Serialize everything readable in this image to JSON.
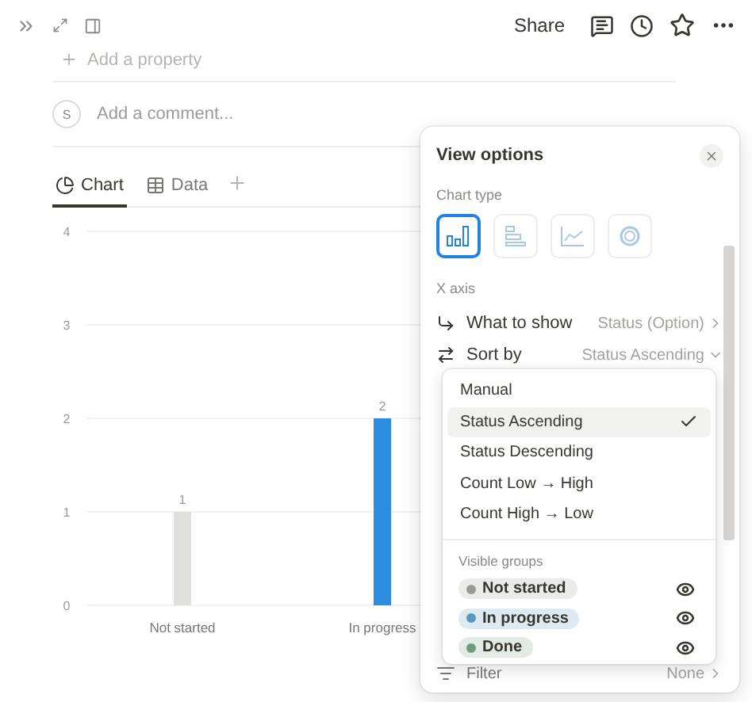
{
  "header": {
    "share": "Share"
  },
  "property_link": "Add a property",
  "comment": {
    "avatar": "S",
    "placeholder": "Add a comment..."
  },
  "view_tabs": [
    {
      "label": "Chart",
      "kind": "chart",
      "selected": true
    },
    {
      "label": "Data",
      "kind": "table",
      "selected": false
    }
  ],
  "chart": {
    "chart_data": {
      "type": "bar",
      "categories": [
        "Not started",
        "In progress"
      ],
      "values": [
        1,
        2
      ],
      "ylim": [
        0,
        4
      ],
      "yticks": [
        0,
        1,
        2,
        3,
        4
      ],
      "grid": true,
      "data_labels": true
    }
  },
  "view_options": {
    "title": "View options",
    "chart_type_label": "Chart type",
    "chart_types": [
      {
        "kind": "vertical-bar",
        "selected": true
      },
      {
        "kind": "horizontal-bar",
        "selected": false
      },
      {
        "kind": "line",
        "selected": false
      },
      {
        "kind": "donut",
        "selected": false
      }
    ],
    "x_axis_label": "X axis",
    "rows": [
      {
        "kind": "what",
        "label": "What to show",
        "value": "Status (Option)"
      },
      {
        "kind": "sort",
        "label": "Sort by",
        "value": "Status Ascending"
      }
    ],
    "filter": {
      "label": "Filter",
      "value": "None"
    }
  },
  "sort_menu": {
    "options": [
      {
        "label": "Manual",
        "selected": false
      },
      {
        "label": "Status Ascending",
        "selected": true
      },
      {
        "label": "Status Descending",
        "selected": false
      },
      {
        "label": "Count Low → High",
        "selected": false
      },
      {
        "label": "Count High → Low",
        "selected": false
      }
    ],
    "groups_label": "Visible groups",
    "groups": [
      {
        "label": "Not started",
        "color": "#9b9a97",
        "visible": true
      },
      {
        "label": "In progress",
        "color": "#5b97bd",
        "visible": true
      },
      {
        "label": "Done",
        "color": "#6c9b7d",
        "visible": true
      }
    ]
  }
}
